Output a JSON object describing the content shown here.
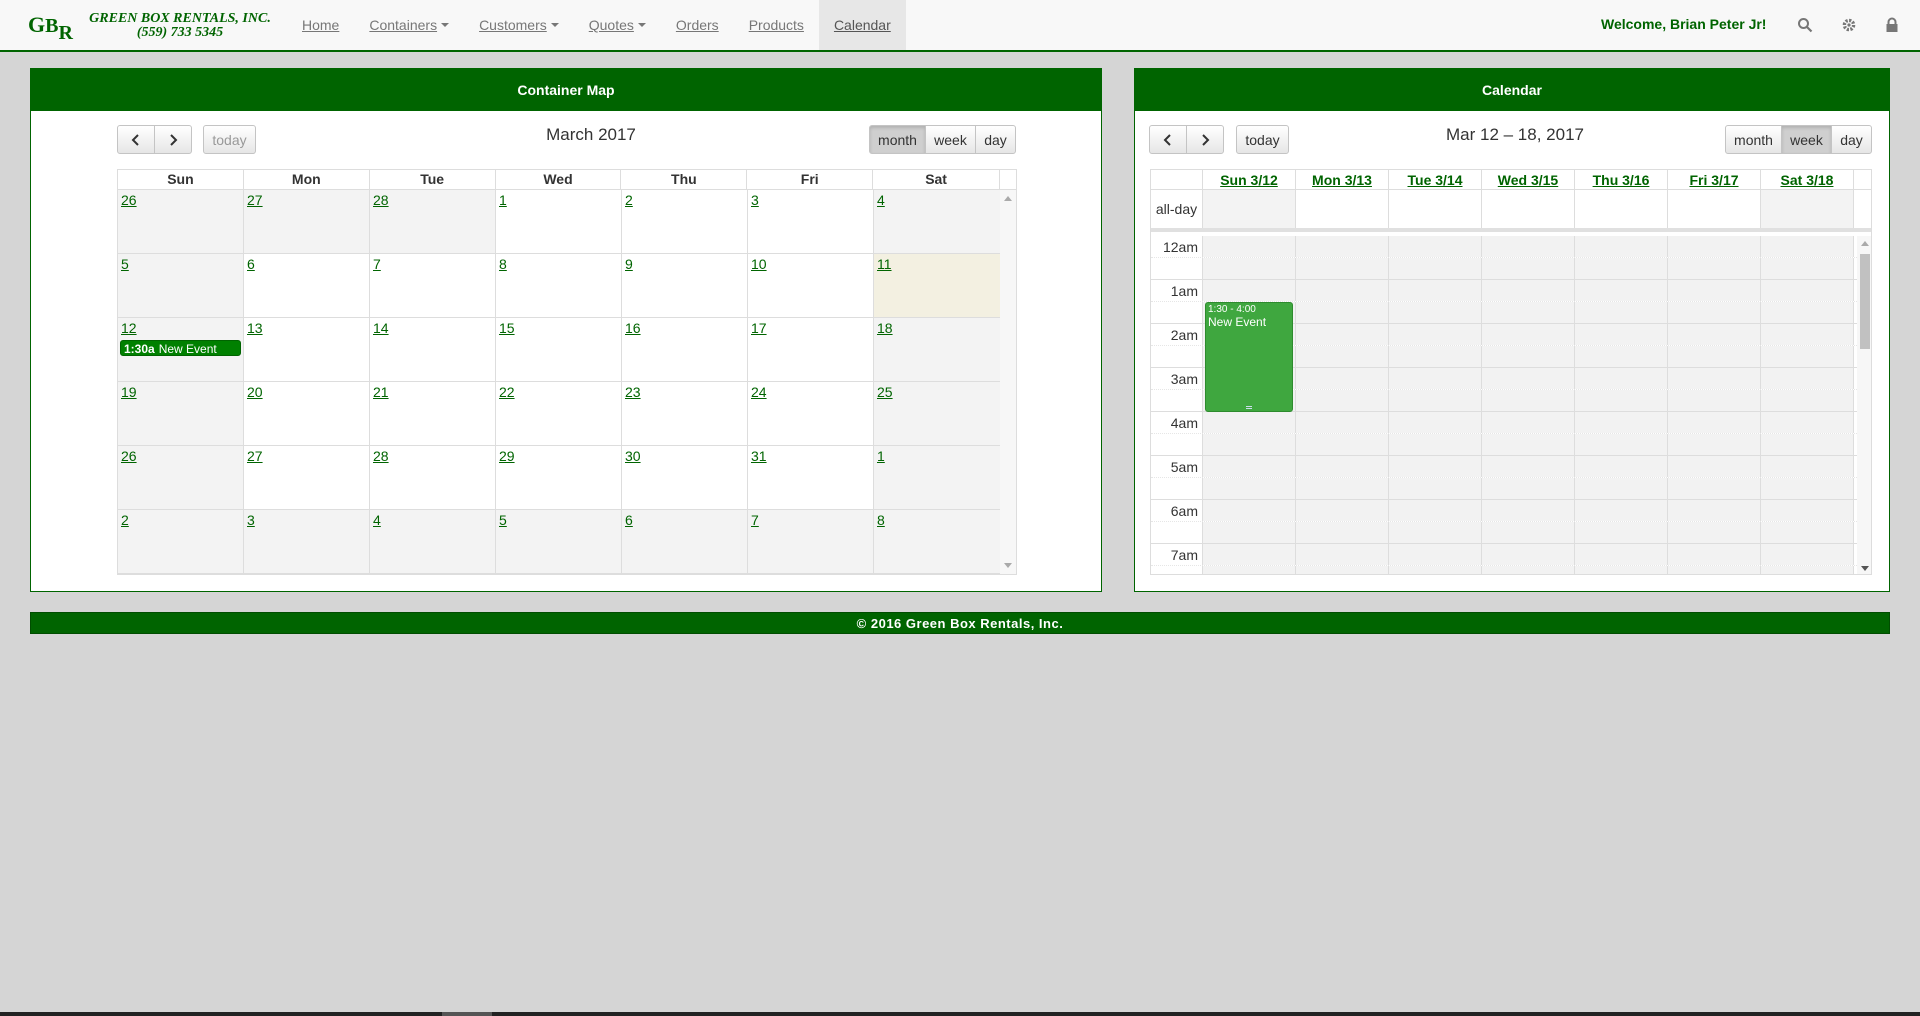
{
  "app": {
    "brand_initials_1": "G",
    "brand_initials_2": "B",
    "brand_initials_3": "R",
    "brand_name": "GREEN BOX RENTALS, INC.",
    "brand_phone": "(559) 733 5345",
    "accent_color": "#006400"
  },
  "nav": {
    "items": [
      {
        "label": "Home"
      },
      {
        "label": "Containers",
        "dropdown": true
      },
      {
        "label": "Customers",
        "dropdown": true
      },
      {
        "label": "Quotes",
        "dropdown": true
      },
      {
        "label": "Orders"
      },
      {
        "label": "Products"
      },
      {
        "label": "Calendar",
        "active": true
      }
    ],
    "welcome": "Welcome, Brian Peter Jr!",
    "icons": [
      "search-icon",
      "gear-icon",
      "lock-icon"
    ]
  },
  "container_map": {
    "title": "Container Map",
    "toolbar": {
      "today": "today",
      "title": "March 2017",
      "views": [
        "month",
        "week",
        "day"
      ],
      "active_view": "month"
    },
    "weekdays": [
      "Sun",
      "Mon",
      "Tue",
      "Wed",
      "Thu",
      "Fri",
      "Sat"
    ],
    "weeks": [
      [
        "26",
        "27",
        "28",
        "1",
        "2",
        "3",
        "4"
      ],
      [
        "5",
        "6",
        "7",
        "8",
        "9",
        "10",
        "11"
      ],
      [
        "12",
        "13",
        "14",
        "15",
        "16",
        "17",
        "18"
      ],
      [
        "19",
        "20",
        "21",
        "22",
        "23",
        "24",
        "25"
      ],
      [
        "26",
        "27",
        "28",
        "29",
        "30",
        "31",
        "1"
      ],
      [
        "2",
        "3",
        "4",
        "5",
        "6",
        "7",
        "8"
      ]
    ],
    "today_date": "11",
    "event": {
      "time": "1:30a",
      "title": "New Event",
      "date": "12"
    }
  },
  "calendar": {
    "title": "Calendar",
    "toolbar": {
      "today": "today",
      "title": "Mar 12 – 18, 2017",
      "views": [
        "month",
        "week",
        "day"
      ],
      "active_view": "week"
    },
    "days": [
      "Sun 3/12",
      "Mon 3/13",
      "Tue 3/14",
      "Wed 3/15",
      "Thu 3/16",
      "Fri 3/17",
      "Sat 3/18"
    ],
    "all_day_label": "all-day",
    "hours": [
      "12am",
      "1am",
      "2am",
      "3am",
      "4am",
      "5am",
      "6am",
      "7am"
    ],
    "event": {
      "time": "1:30 - 4:00",
      "title": "New Event",
      "start_hour": 1.5,
      "end_hour": 4.0
    }
  },
  "footer": {
    "text": "© 2016 Green Box Rentals, Inc."
  }
}
